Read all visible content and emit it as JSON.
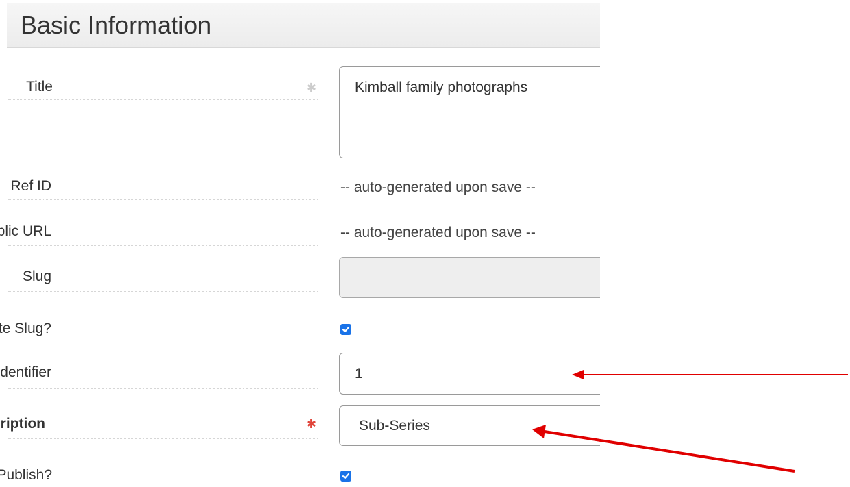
{
  "section": {
    "title": "Basic Information"
  },
  "fields": {
    "title": {
      "label": "Title",
      "value": "Kimball family photographs"
    },
    "ref_id": {
      "label": "Ref ID",
      "value": "-- auto-generated upon save --"
    },
    "public_url": {
      "label": "Public URL",
      "value": "-- auto-generated upon save --"
    },
    "slug": {
      "label": "Slug",
      "value": ""
    },
    "auto_slug": {
      "label": "Automatically Generate Slug?",
      "checked": true
    },
    "component_unique_identifier": {
      "label": "Component Unique Identifier",
      "value": "1"
    },
    "level_of_description": {
      "label": "Level of Description",
      "value": "Sub-Series"
    },
    "publish": {
      "label": "Publish?",
      "checked": true
    }
  },
  "colors": {
    "required_star": "#e0443a",
    "optional_star": "#cccccc",
    "checkbox": "#1a73e8",
    "annotation_arrow": "#e00000"
  },
  "icons": {
    "checkbox_check": "checkmark-icon",
    "required": "asterisk-icon",
    "annotation": "arrow-left-icon"
  }
}
